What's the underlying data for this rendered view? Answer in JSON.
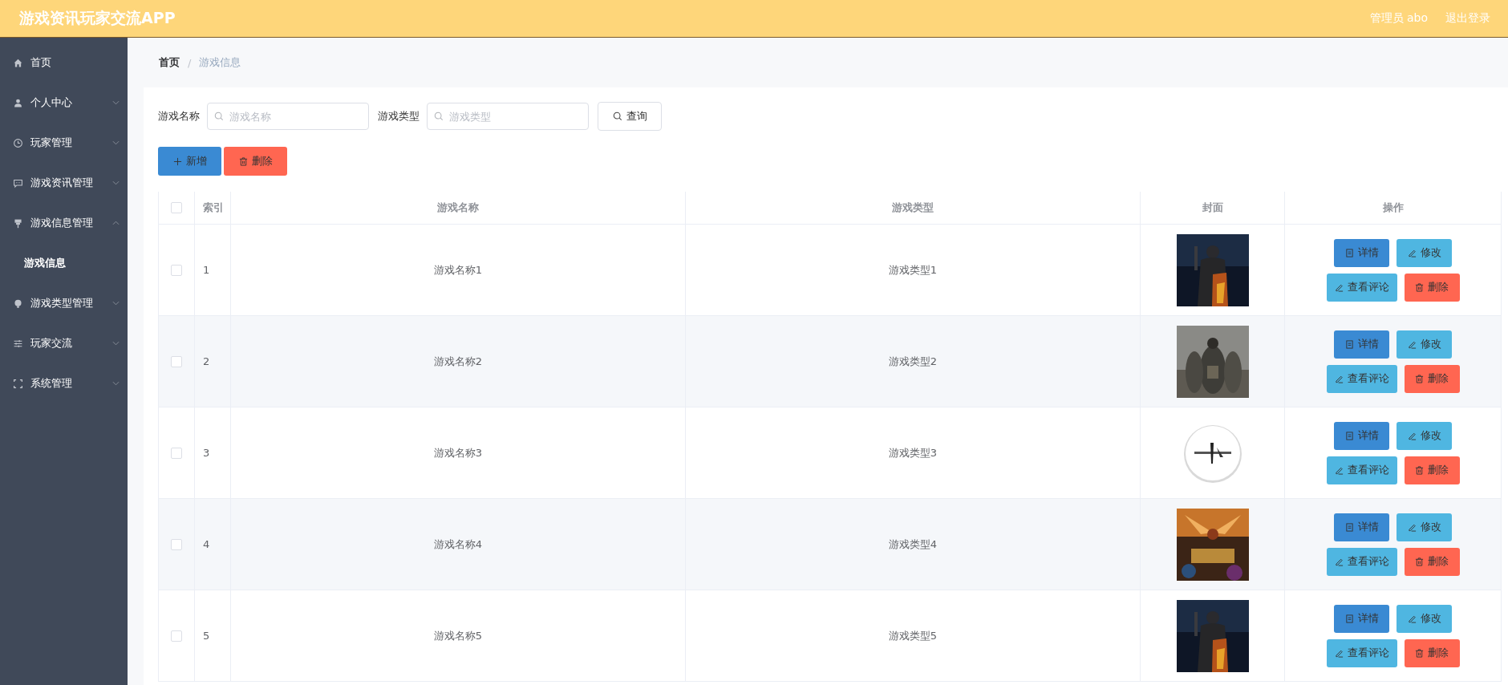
{
  "header": {
    "title": "游戏资讯玩家交流APP",
    "user": "管理员 abo",
    "logout": "退出登录"
  },
  "sidebar": {
    "items": [
      {
        "label": "首页"
      },
      {
        "label": "个人中心",
        "expanded": false
      },
      {
        "label": "玩家管理",
        "expanded": false
      },
      {
        "label": "游戏资讯管理",
        "expanded": false
      },
      {
        "label": "游戏信息管理",
        "expanded": true,
        "children": [
          {
            "label": "游戏信息",
            "selected": true
          }
        ]
      },
      {
        "label": "游戏类型管理",
        "expanded": false
      },
      {
        "label": "玩家交流",
        "expanded": false
      },
      {
        "label": "系统管理",
        "expanded": false
      }
    ]
  },
  "breadcrumb": {
    "items": [
      "首页",
      "游戏信息"
    ],
    "separator": "/"
  },
  "search": {
    "fields": [
      {
        "label": "游戏名称",
        "placeholder": "游戏名称"
      },
      {
        "label": "游戏类型",
        "placeholder": "游戏类型"
      }
    ],
    "button": "查询"
  },
  "toolbar": [
    {
      "kind": "add",
      "label": "新增"
    },
    {
      "kind": "delete",
      "label": "删除"
    }
  ],
  "table": {
    "header_checked": false,
    "columns": [
      "索引",
      "游戏名称",
      "游戏类型",
      "封面",
      "操作"
    ],
    "rows": [
      {
        "checked": false,
        "index": "1",
        "name": "游戏名称1",
        "type": "游戏类型1",
        "cover": {
          "kind": "picture"
        },
        "actions": [
          {
            "kind": "detail",
            "label": "详情"
          },
          {
            "kind": "edit",
            "label": "修改"
          },
          {
            "kind": "comment",
            "label": "查看评论"
          },
          {
            "kind": "delete",
            "label": "删除"
          }
        ]
      },
      {
        "checked": false,
        "index": "2",
        "name": "游戏名称2",
        "type": "游戏类型2",
        "cover": {
          "kind": "picture"
        },
        "actions": [
          {
            "kind": "detail",
            "label": "详情"
          },
          {
            "kind": "edit",
            "label": "修改"
          },
          {
            "kind": "comment",
            "label": "查看评论"
          },
          {
            "kind": "delete",
            "label": "删除"
          }
        ]
      },
      {
        "checked": false,
        "index": "3",
        "name": "游戏名称3",
        "type": "游戏类型3",
        "cover": {
          "kind": "picture"
        },
        "actions": [
          {
            "kind": "detail",
            "label": "详情"
          },
          {
            "kind": "edit",
            "label": "修改"
          },
          {
            "kind": "comment",
            "label": "查看评论"
          },
          {
            "kind": "delete",
            "label": "删除"
          }
        ]
      },
      {
        "checked": false,
        "index": "4",
        "name": "游戏名称4",
        "type": "游戏类型4",
        "cover": {
          "kind": "picture"
        },
        "actions": [
          {
            "kind": "detail",
            "label": "详情"
          },
          {
            "kind": "edit",
            "label": "修改"
          },
          {
            "kind": "comment",
            "label": "查看评论"
          },
          {
            "kind": "delete",
            "label": "删除"
          }
        ]
      },
      {
        "checked": false,
        "index": "5",
        "name": "游戏名称5",
        "type": "游戏类型5",
        "cover": {
          "kind": "picture"
        },
        "actions": [
          {
            "kind": "detail",
            "label": "详情"
          },
          {
            "kind": "edit",
            "label": "修改"
          },
          {
            "kind": "comment",
            "label": "查看评论"
          },
          {
            "kind": "delete",
            "label": "删除"
          }
        ]
      }
    ]
  }
}
